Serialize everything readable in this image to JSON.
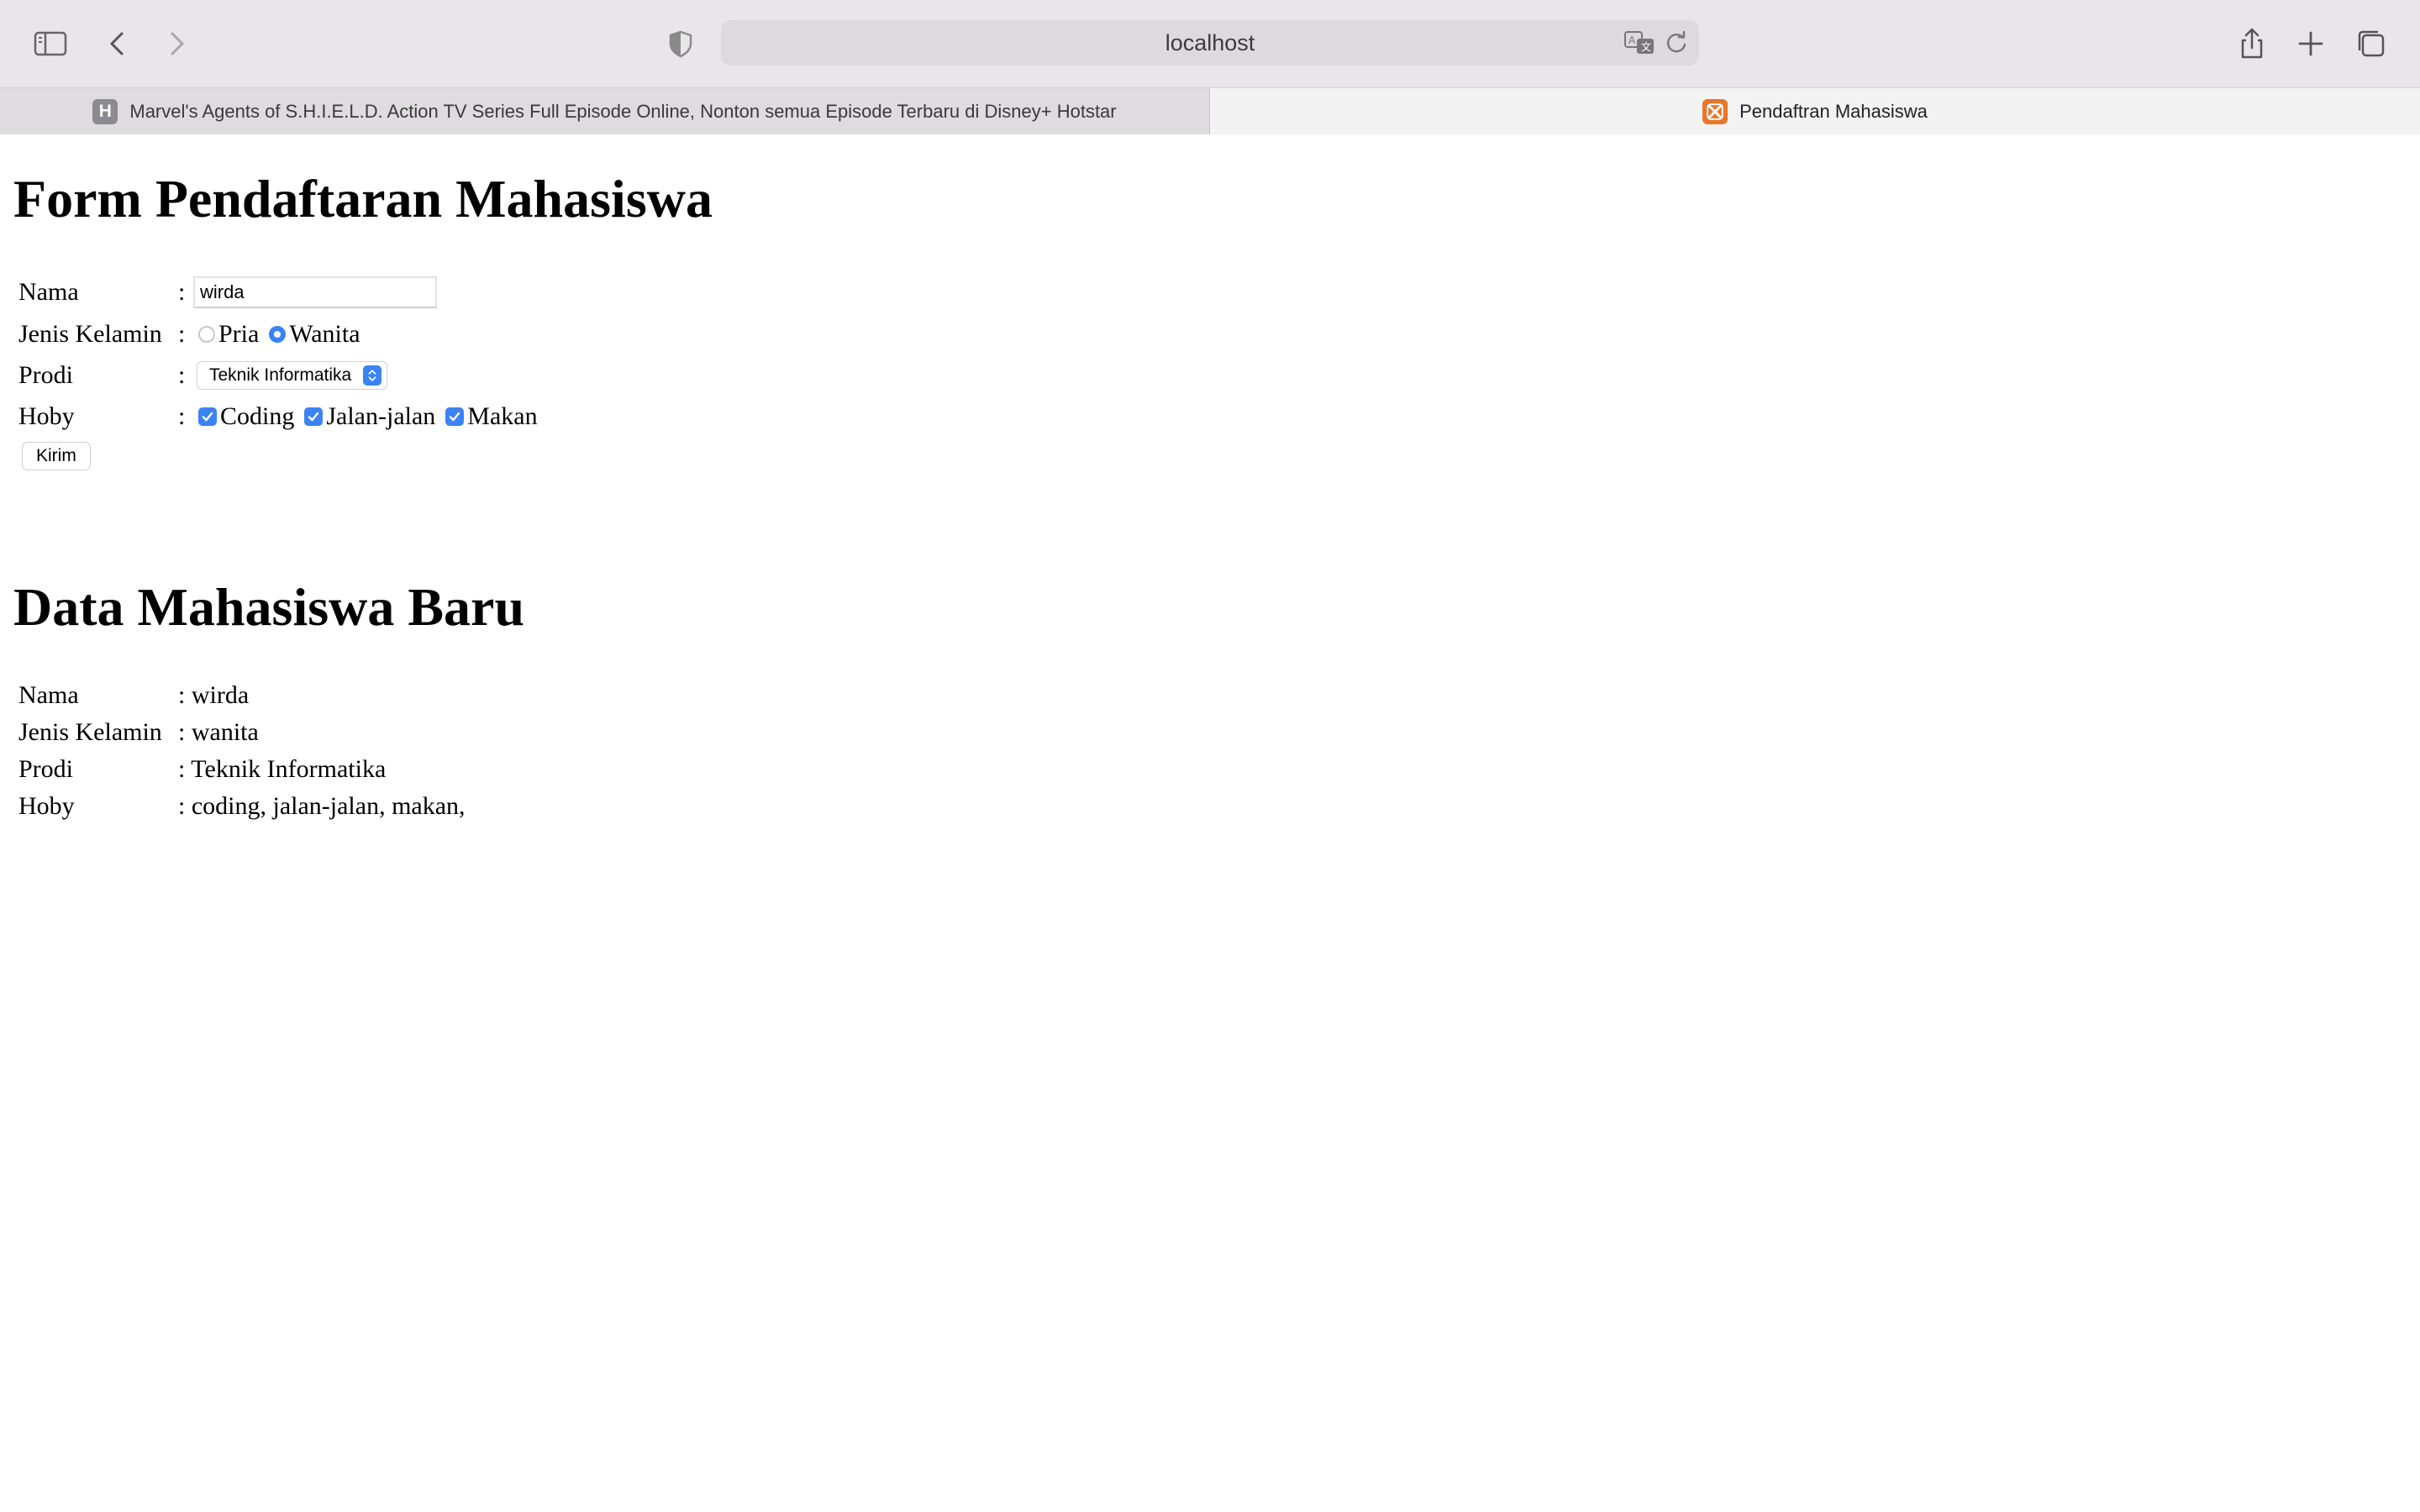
{
  "browser": {
    "url": "localhost",
    "tabs": [
      {
        "label": "Marvel's Agents of S.H.I.E.L.D. Action TV Series Full Episode Online, Nonton semua Episode Terbaru di Disney+ Hotstar",
        "favicon": "H"
      },
      {
        "label": "Pendaftran Mahasiswa",
        "favicon": "xampp-icon"
      }
    ]
  },
  "form": {
    "title": "Form Pendaftaran Mahasiswa",
    "separator": ":",
    "nama": {
      "label": "Nama",
      "value": "wirda"
    },
    "jenis_kelamin": {
      "label": "Jenis Kelamin",
      "options": [
        "Pria",
        "Wanita"
      ],
      "selected": "Wanita"
    },
    "prodi": {
      "label": "Prodi",
      "value": "Teknik Informatika"
    },
    "hoby": {
      "label": "Hoby",
      "options": [
        "Coding",
        "Jalan-jalan",
        "Makan"
      ],
      "checked": [
        "Coding",
        "Jalan-jalan",
        "Makan"
      ]
    },
    "submit_label": "Kirim"
  },
  "data": {
    "title": "Data Mahasiswa Baru",
    "rows": [
      {
        "label": "Nama",
        "value": ": wirda"
      },
      {
        "label": "Jenis Kelamin",
        "value": ": wanita"
      },
      {
        "label": "Prodi",
        "value": ": Teknik Informatika"
      },
      {
        "label": "Hoby",
        "value": ": coding, jalan-jalan, makan,"
      }
    ]
  },
  "colors": {
    "accent": "#3b82f6",
    "chrome": "#e8e6e8",
    "active_tab": "#f4f3f4"
  }
}
